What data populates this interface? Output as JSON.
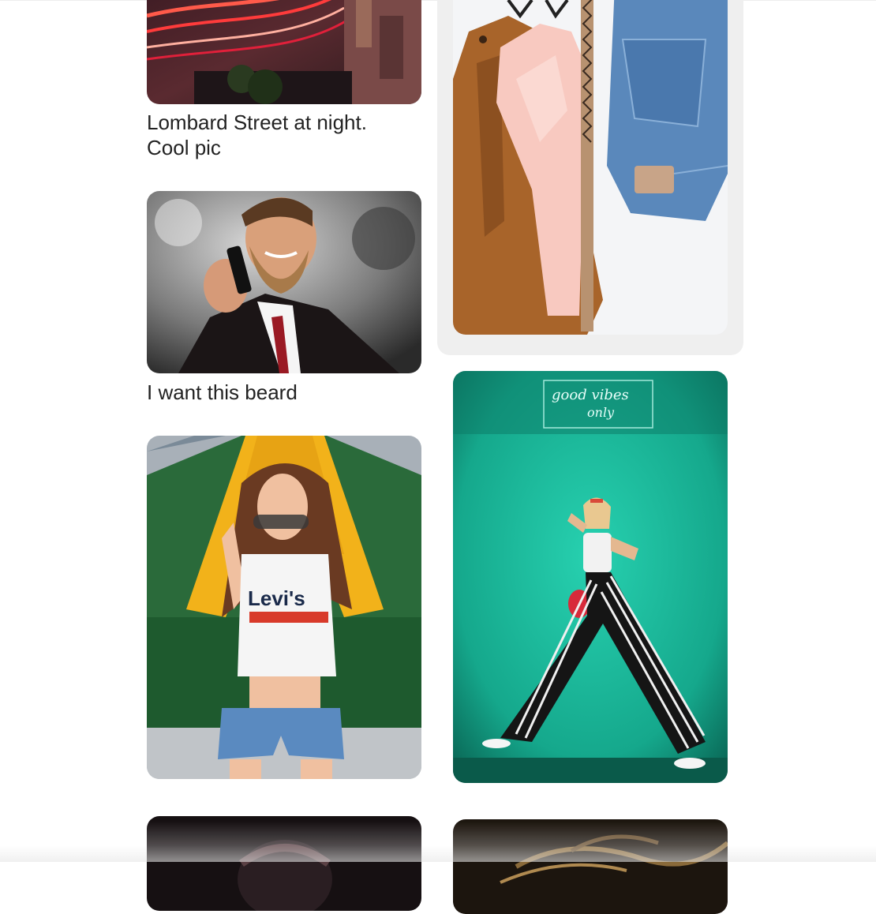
{
  "feed": {
    "pins": [
      {
        "id": "lombard",
        "caption_line1": "Lombard Street at night.",
        "caption_line2": "Cool pic",
        "image_alt": "Lombard Street at night with light trails"
      },
      {
        "id": "clothes",
        "caption": "",
        "image_alt": "Clothes on hangers: brown jacket, pink blouse, belt, jeans"
      },
      {
        "id": "beard",
        "caption": "I want this beard",
        "image_alt": "Bearded man in suit on phone"
      },
      {
        "id": "teal",
        "caption": "",
        "image_alt": "Woman in striped pants against teal wall with neon sign",
        "neon_text": "good vibes only"
      },
      {
        "id": "levis",
        "caption": "",
        "image_alt": "Woman in Levi's top with sunglasses",
        "shirt_text": "Levi's"
      },
      {
        "id": "bottom-left",
        "caption": "",
        "image_alt": "Dark portrait"
      },
      {
        "id": "bottom-right",
        "caption": "",
        "image_alt": "Dark abstract"
      }
    ]
  },
  "colors": {
    "background": "#ffffff",
    "hover_card": "#efefef",
    "caption_text": "#222222",
    "teal": "#1fb59a"
  }
}
